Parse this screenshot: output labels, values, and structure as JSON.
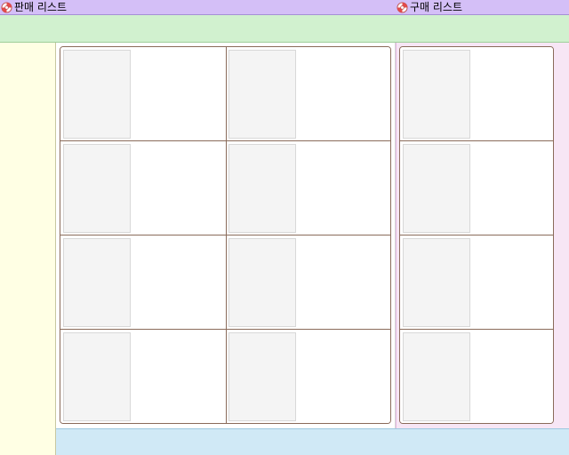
{
  "header": {
    "sell_list_label": "판매 리스트",
    "buy_list_label": "구매 리스트",
    "icon": "lifebuoy-icon"
  },
  "sell_list": {
    "columns": 2,
    "rows": 4,
    "slots": [
      {
        "id": "sell-1"
      },
      {
        "id": "sell-2"
      },
      {
        "id": "sell-3"
      },
      {
        "id": "sell-4"
      },
      {
        "id": "sell-5"
      },
      {
        "id": "sell-6"
      },
      {
        "id": "sell-7"
      },
      {
        "id": "sell-8"
      }
    ]
  },
  "buy_list": {
    "columns": 1,
    "rows": 4,
    "slots": [
      {
        "id": "buy-1"
      },
      {
        "id": "buy-2"
      },
      {
        "id": "buy-3"
      },
      {
        "id": "buy-4"
      }
    ]
  },
  "colors": {
    "topbar": "#d4bff7",
    "green_strip": "#d1f1cf",
    "left_column": "#ffffe4",
    "right_panel": "#f7e6f5",
    "bottom_bar": "#d0e9f6",
    "grid_border": "#8a6b5a"
  }
}
